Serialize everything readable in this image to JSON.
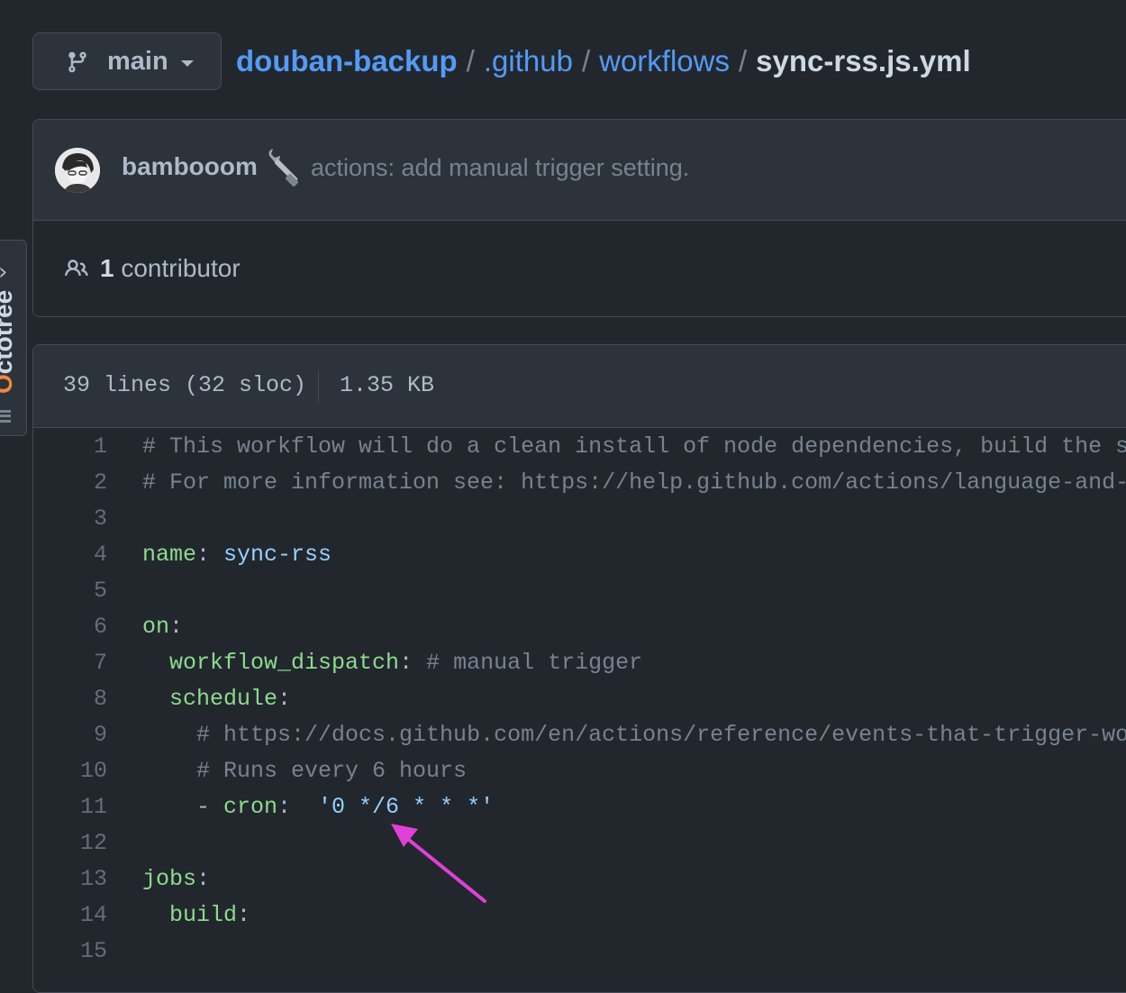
{
  "branch": {
    "name": "main",
    "icon": "git-branch-icon"
  },
  "breadcrumb": {
    "repo": "douban-backup",
    "parts": [
      ".github",
      "workflows"
    ],
    "separator": "/",
    "file": "sync-rss.js.yml"
  },
  "commit": {
    "author": "bambooom",
    "emoji_icon": "wrench-icon",
    "message": "actions: add manual trigger setting."
  },
  "contributors": {
    "count": "1",
    "label": "contributor",
    "icon": "people-icon"
  },
  "sidebar": {
    "octotree_label": "Octotree",
    "octotree_first": "O",
    "octotree_rest": "ctotree"
  },
  "file_info": {
    "lines": "39 lines (32 sloc)",
    "size": "1.35 KB"
  },
  "code_lines": [
    {
      "n": "1",
      "tokens": [
        {
          "t": "# This workflow will do a clean install of node dependencies, build the sour",
          "c": "comment"
        }
      ]
    },
    {
      "n": "2",
      "tokens": [
        {
          "t": "# For more information see: https://help.github.com/actions/language-and-fra",
          "c": "comment"
        }
      ]
    },
    {
      "n": "3",
      "tokens": []
    },
    {
      "n": "4",
      "tokens": [
        {
          "t": "name",
          "c": "key"
        },
        {
          "t": ": ",
          "c": "punct"
        },
        {
          "t": "sync-rss",
          "c": "val"
        }
      ]
    },
    {
      "n": "5",
      "tokens": []
    },
    {
      "n": "6",
      "tokens": [
        {
          "t": "on",
          "c": "key"
        },
        {
          "t": ":",
          "c": "punct"
        }
      ]
    },
    {
      "n": "7",
      "tokens": [
        {
          "t": "  ",
          "c": "punct"
        },
        {
          "t": "workflow_dispatch",
          "c": "key"
        },
        {
          "t": ": ",
          "c": "punct"
        },
        {
          "t": "# manual trigger",
          "c": "comment"
        }
      ]
    },
    {
      "n": "8",
      "tokens": [
        {
          "t": "  ",
          "c": "punct"
        },
        {
          "t": "schedule",
          "c": "key"
        },
        {
          "t": ":",
          "c": "punct"
        }
      ]
    },
    {
      "n": "9",
      "tokens": [
        {
          "t": "    ",
          "c": "punct"
        },
        {
          "t": "# https://docs.github.com/en/actions/reference/events-that-trigger-workf",
          "c": "comment"
        }
      ]
    },
    {
      "n": "10",
      "tokens": [
        {
          "t": "    ",
          "c": "punct"
        },
        {
          "t": "# Runs every 6 hours",
          "c": "comment"
        }
      ]
    },
    {
      "n": "11",
      "tokens": [
        {
          "t": "    - ",
          "c": "punct"
        },
        {
          "t": "cron",
          "c": "key"
        },
        {
          "t": ":  ",
          "c": "punct"
        },
        {
          "t": "'0 */6 * * *'",
          "c": "val"
        }
      ]
    },
    {
      "n": "12",
      "tokens": []
    },
    {
      "n": "13",
      "tokens": [
        {
          "t": "jobs",
          "c": "key"
        },
        {
          "t": ":",
          "c": "punct"
        }
      ]
    },
    {
      "n": "14",
      "tokens": [
        {
          "t": "  ",
          "c": "punct"
        },
        {
          "t": "build",
          "c": "key"
        },
        {
          "t": ":",
          "c": "punct"
        }
      ]
    },
    {
      "n": "15",
      "tokens": []
    }
  ],
  "colors": {
    "background": "#22272e",
    "link": "#539bf5",
    "yaml_key": "#8ddb8c",
    "yaml_value": "#96d0ff",
    "comment": "#768390",
    "annotation_arrow": "#e040d8"
  }
}
